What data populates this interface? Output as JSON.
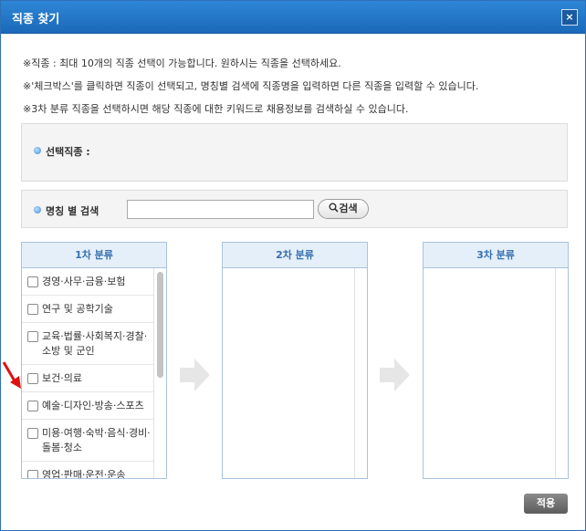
{
  "window": {
    "title": "직종 찾기",
    "close_label": "×"
  },
  "notes": [
    "※직종 : 최대 10개의 직종 선택이 가능합니다. 원하시는 직종을 선택하세요.",
    "※'체크박스'를 클릭하면 직종이 선택되고, 명칭별 검색에 직종명을 입력하면 다른 직종을 입력할 수 있습니다.",
    "※3차 분류 직종을 선택하시면 해당 직종에 대한 키워드로 채용정보를 검색하실 수 있습니다."
  ],
  "selected": {
    "label": "선택직종 :"
  },
  "search": {
    "label": "명칭 별 검색",
    "value": "",
    "button_label": "검색"
  },
  "columns": [
    {
      "title": "1차 분류"
    },
    {
      "title": "2차 분류"
    },
    {
      "title": "3차 분류"
    }
  ],
  "level1_items": [
    "경영·사무·금융·보험",
    "연구 및 공학기술",
    "교육·법률·사회복지·경찰·소방 및 군인",
    "보건·의료",
    "예술·디자인·방송·스포츠",
    "미용·여행·숙박·음식·경비·돌봄·청소",
    "영업·판매·운전·운송"
  ],
  "apply_label": "적용",
  "colors": {
    "accent": "#1b69b9",
    "pointer_arrow": "#e01010",
    "flow_arrow": "#e6e6e6"
  }
}
